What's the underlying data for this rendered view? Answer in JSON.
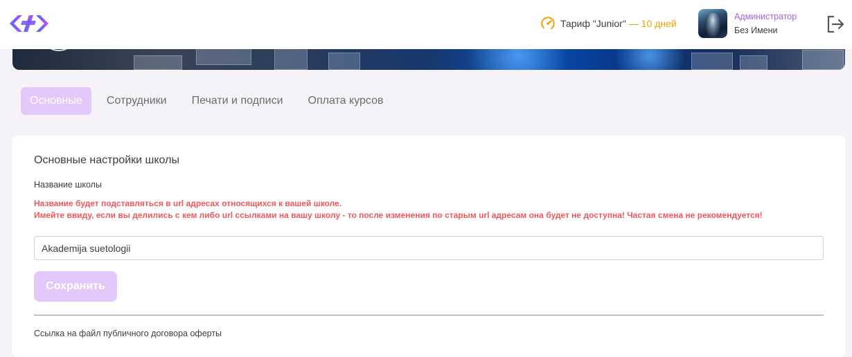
{
  "header": {
    "logo_icon": "brand-chevrons-icon",
    "tariff_icon": "speedometer-icon",
    "tariff_label": "Тариф \"Junior\"",
    "tariff_days": "— 10 дней",
    "role": "Администратор",
    "user_name": "Без Имени",
    "logout_icon": "logout-icon"
  },
  "tabs": [
    {
      "label": "Основные",
      "active": true
    },
    {
      "label": "Сотрудники",
      "active": false
    },
    {
      "label": "Печати и подписи",
      "active": false
    },
    {
      "label": "Оплата курсов",
      "active": false
    }
  ],
  "card": {
    "title": "Основные настройки школы",
    "school_name_label": "Название школы",
    "warning_line1": "Название будет подставляться в url адресах относящихся к вашей школе.",
    "warning_line2": "Имейте ввиду, если вы делились с кем либо url ссылками на вашу школу - то после изменения по старым url адресам она будет не доступна! Частая смена не рекомендуется!",
    "school_name_value": "Akademija suetologii",
    "save_label": "Сохранить",
    "offer_link_label": "Ссылка на файл публичного договора оферты"
  },
  "colors": {
    "accent": "#a463e8",
    "accent_light": "#e3c9fb",
    "warning": "#f0575d",
    "tariff_days": "#f2a100"
  }
}
